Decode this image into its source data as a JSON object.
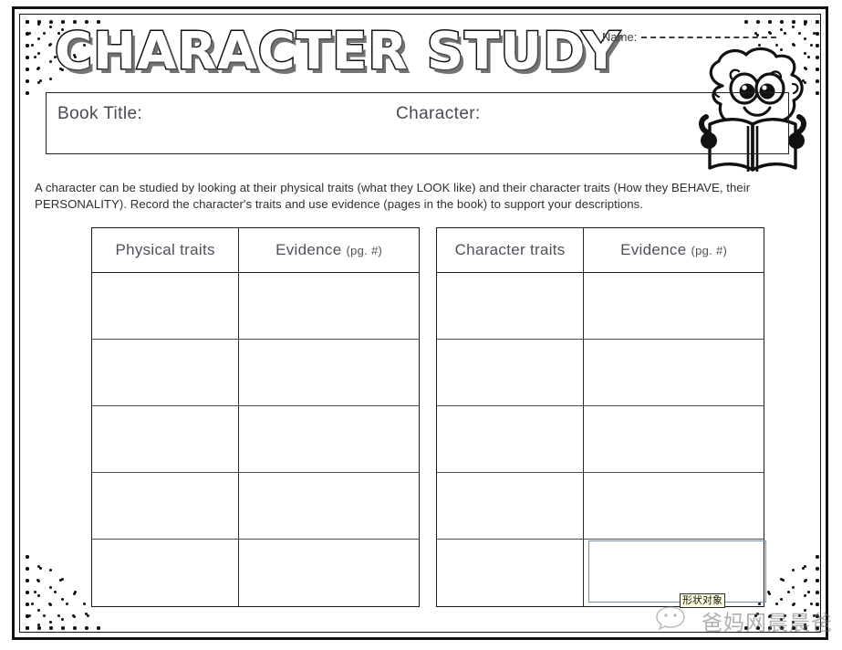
{
  "worksheet": {
    "title": "CHARACTER STUDY",
    "name_label": "Name:",
    "book_title_label": "Book Title:",
    "character_label": "Character:",
    "instructions": "A character can be studied by looking at their physical traits (what they LOOK like) and their character traits (How they BEHAVE, their PERSONALITY).  Record the character's traits and use evidence (pages in the book) to support your descriptions."
  },
  "tables": {
    "left": {
      "headers": [
        {
          "main": "Physical traits",
          "sub": ""
        },
        {
          "main": "Evidence ",
          "sub": "(pg. #)"
        }
      ],
      "body_rows": 5,
      "cells": [
        [
          "",
          ""
        ],
        [
          "",
          ""
        ],
        [
          "",
          ""
        ],
        [
          "",
          ""
        ],
        [
          "",
          ""
        ]
      ]
    },
    "right": {
      "headers": [
        {
          "main": "Character traits",
          "sub": ""
        },
        {
          "main": "Evidence ",
          "sub": "(pg. #)"
        }
      ],
      "body_rows": 5,
      "cells": [
        [
          "",
          ""
        ],
        [
          "",
          ""
        ],
        [
          "",
          ""
        ],
        [
          "",
          ""
        ],
        [
          "",
          ""
        ]
      ]
    }
  },
  "overlay": {
    "tooltip_text": "形状对象",
    "selection_color": "#6f8fb5"
  },
  "watermark": {
    "text": "爸妈网晨晨爸",
    "logo": "wechat-icon"
  },
  "icons": {
    "mascot": "sheep-reading-book-icon",
    "wechat": "wechat-bubble-icon"
  },
  "colors": {
    "ink": "#1b1b1b",
    "text_gray": "#50505a",
    "selection_blue": "#6f8fb5",
    "tooltip_bg": "#ffffe1"
  }
}
